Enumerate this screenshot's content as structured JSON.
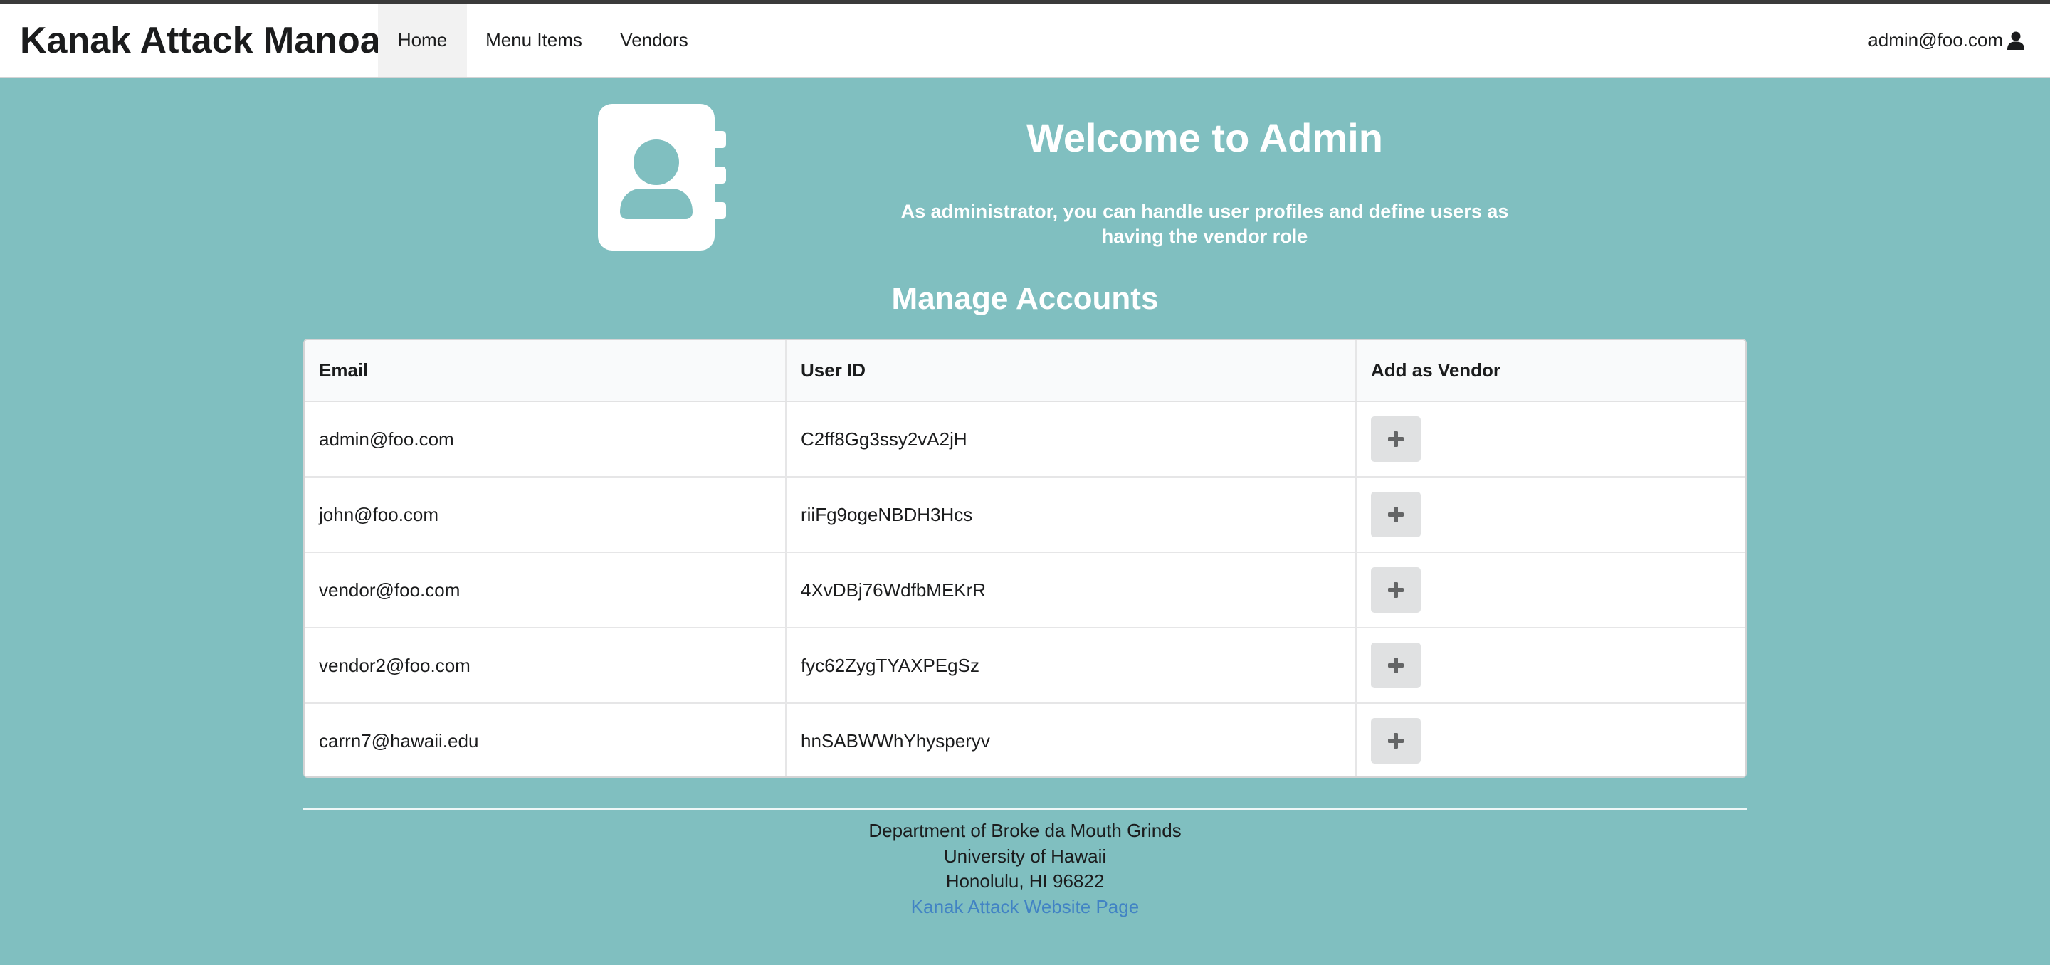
{
  "header": {
    "brand": "Kanak Attack Manoa",
    "nav": {
      "home": "Home",
      "menu_items": "Menu Items",
      "vendors": "Vendors"
    },
    "user_email": "admin@foo.com",
    "user_icon": "user-icon"
  },
  "hero": {
    "icon": "address-book-icon",
    "title": "Welcome to Admin",
    "subtitle": "As administrator, you can handle user profiles and define users as having the vendor role"
  },
  "accounts": {
    "title": "Manage Accounts",
    "columns": [
      "Email",
      "User ID",
      "Add as Vendor"
    ],
    "add_icon": "plus-icon",
    "rows": [
      {
        "email": "admin@foo.com",
        "user_id": "C2ff8Gg3ssy2vA2jH"
      },
      {
        "email": "john@foo.com",
        "user_id": "riiFg9ogeNBDH3Hcs"
      },
      {
        "email": "vendor@foo.com",
        "user_id": "4XvDBj76WdfbMEKrR"
      },
      {
        "email": "vendor2@foo.com",
        "user_id": "fyc62ZygTYAXPEgSz"
      },
      {
        "email": "carrn7@hawaii.edu",
        "user_id": "hnSABWWhYhysperyv"
      }
    ]
  },
  "footer": {
    "line1": "Department of Broke da Mouth Grinds",
    "line2": "University of Hawaii",
    "line3": "Honolulu, HI 96822",
    "link_text": "Kanak Attack Website Page"
  },
  "colors": {
    "background": "#80bfc0",
    "header_bg": "#ffffff",
    "link": "#4183c4",
    "button_bg": "#e0e1e2"
  }
}
